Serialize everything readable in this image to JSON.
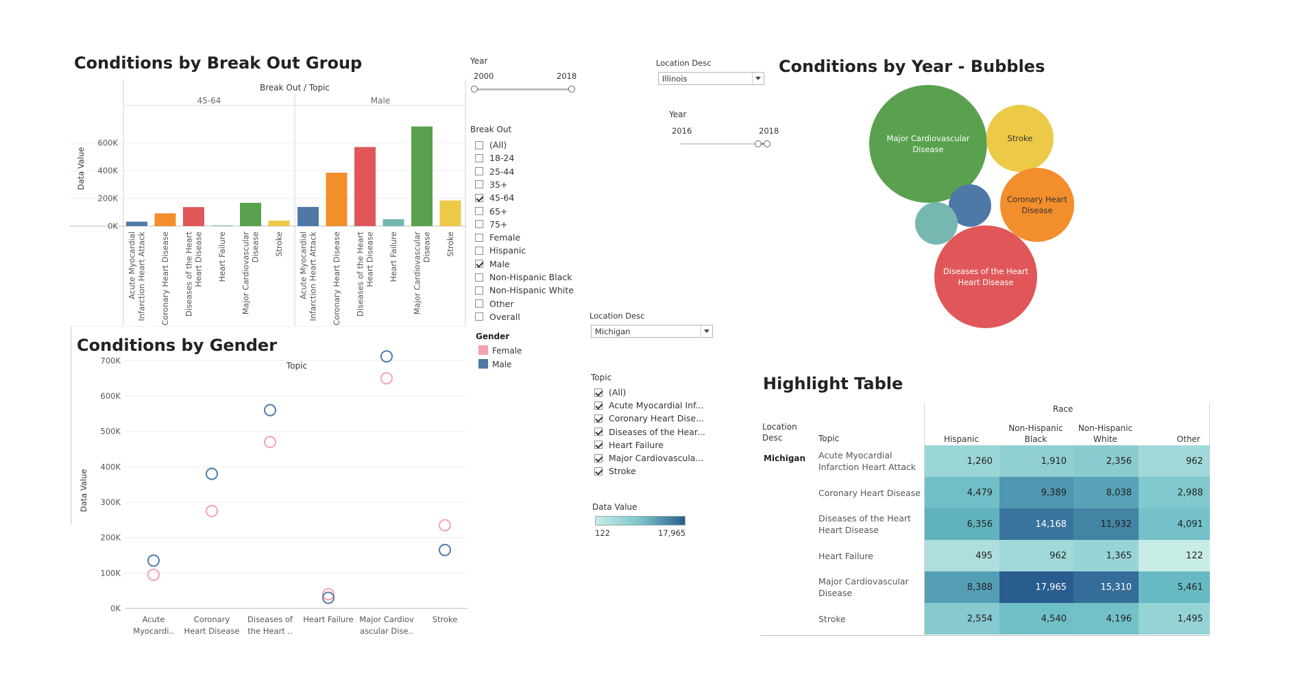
{
  "panels": {
    "breakout_title": "Conditions by Break Out Group",
    "gender_title": "Conditions by Gender",
    "bubbles_title": "Conditions by Year - Bubbles",
    "highlight_title": "Highlight Table"
  },
  "filters": {
    "year1": {
      "label": "Year",
      "min": "2000",
      "max": "2018"
    },
    "breakout": {
      "label": "Break Out",
      "items": [
        {
          "label": "(All)",
          "checked": false
        },
        {
          "label": "18-24",
          "checked": false
        },
        {
          "label": "25-44",
          "checked": false
        },
        {
          "label": "35+",
          "checked": false
        },
        {
          "label": "45-64",
          "checked": true
        },
        {
          "label": "65+",
          "checked": false
        },
        {
          "label": "75+",
          "checked": false
        },
        {
          "label": "Female",
          "checked": false
        },
        {
          "label": "Hispanic",
          "checked": false
        },
        {
          "label": "Male",
          "checked": true
        },
        {
          "label": "Non-Hispanic Black",
          "checked": false
        },
        {
          "label": "Non-Hispanic White",
          "checked": false
        },
        {
          "label": "Other",
          "checked": false
        },
        {
          "label": "Overall",
          "checked": false
        }
      ]
    },
    "gender_legend": {
      "label": "Gender",
      "items": [
        {
          "label": "Female",
          "color": "#f4a3ad"
        },
        {
          "label": "Male",
          "color": "#4e79a7"
        }
      ]
    },
    "location1": {
      "label": "Location Desc",
      "value": "Illinois"
    },
    "year2": {
      "label": "Year",
      "min": "2016",
      "max": "2018"
    },
    "location2": {
      "label": "Location Desc",
      "value": "Michigan"
    },
    "topic": {
      "label": "Topic",
      "items": [
        {
          "label": "(All)",
          "checked": true
        },
        {
          "label": "Acute Myocardial Inf...",
          "checked": true
        },
        {
          "label": "Coronary Heart Dise...",
          "checked": true
        },
        {
          "label": "Diseases of the Hear...",
          "checked": true
        },
        {
          "label": "Heart Failure",
          "checked": true
        },
        {
          "label": "Major Cardiovascula...",
          "checked": true
        },
        {
          "label": "Stroke",
          "checked": true
        }
      ]
    },
    "data_value_legend": {
      "label": "Data Value",
      "min": "122",
      "max": "17,965",
      "color_low": "#c7ece6",
      "color_high": "#2a5d8f"
    }
  },
  "chart_data": [
    {
      "type": "bar",
      "name": "breakout",
      "title": "Conditions by Break Out Group",
      "header": "Break Out / Topic",
      "ylabel": "Data Value",
      "ylim": [
        0,
        800000
      ],
      "yticks": [
        0,
        200000,
        400000,
        600000
      ],
      "ytick_labels": [
        "0K",
        "200K",
        "400K",
        "600K"
      ],
      "groups": [
        "45-64",
        "Male"
      ],
      "categories": [
        "Acute Myocardial Infarction Heart Attack",
        "Coronary Heart Disease",
        "Diseases of the Heart Heart Disease",
        "Heart Failure",
        "Major Cardiovascular Disease",
        "Stroke"
      ],
      "category_lines": [
        [
          "Acute Myocardial",
          "Infarction Heart Attack"
        ],
        [
          "Coronary Heart Disease"
        ],
        [
          "Diseases of the Heart",
          "Heart Disease"
        ],
        [
          "Heart Failure"
        ],
        [
          "Major Cardiovascular",
          "Disease"
        ],
        [
          "Stroke"
        ]
      ],
      "colors": [
        "#4e79a7",
        "#f28e2b",
        "#e15759",
        "#76b7b2",
        "#59a14f",
        "#edc948"
      ],
      "series": [
        {
          "name": "45-64",
          "values": [
            32000,
            92000,
            137000,
            5000,
            168000,
            40000
          ]
        },
        {
          "name": "Male",
          "values": [
            138000,
            385000,
            570000,
            50000,
            718000,
            185000
          ]
        }
      ]
    },
    {
      "type": "scatter",
      "name": "gender",
      "title": "Conditions by Gender",
      "header": "Topic",
      "ylabel": "Data Value",
      "ylim": [
        0,
        740000
      ],
      "yticks": [
        0,
        100000,
        200000,
        300000,
        400000,
        500000,
        600000,
        700000
      ],
      "ytick_labels": [
        "0K",
        "100K",
        "200K",
        "300K",
        "400K",
        "500K",
        "600K",
        "700K"
      ],
      "categories": [
        "Acute Myocardial Infarction Heart Attack",
        "Coronary Heart Disease",
        "Diseases of the Heart Heart Disease",
        "Heart Failure",
        "Major Cardiovascular Disease",
        "Stroke"
      ],
      "category_lines": [
        [
          "Acute",
          "Myocardi.."
        ],
        [
          "Coronary",
          "Heart Disease"
        ],
        [
          "Diseases of",
          "the Heart .."
        ],
        [
          "Heart Failure"
        ],
        [
          "Major Cardiov",
          "ascular Dise.."
        ],
        [
          "Stroke"
        ]
      ],
      "series": [
        {
          "name": "Female",
          "color": "#f4a3ad",
          "values": [
            95000,
            275000,
            470000,
            40000,
            650000,
            235000
          ]
        },
        {
          "name": "Male",
          "color": "#4e79a7",
          "values": [
            135000,
            380000,
            560000,
            30000,
            712000,
            165000
          ]
        }
      ]
    },
    {
      "type": "bubble",
      "name": "bubbles",
      "title": "Conditions by Year - Bubbles",
      "bubbles": [
        {
          "label": [
            "Major Cardiovascular",
            "Disease"
          ],
          "color": "#59a14f",
          "value": 1000
        },
        {
          "label": [
            "Stroke"
          ],
          "color": "#edc948",
          "value": 330
        },
        {
          "label": [
            "Coronary Heart",
            "Disease"
          ],
          "color": "#f28e2b",
          "value": 380
        },
        {
          "label": [
            "Diseases of the Heart",
            "Heart Disease"
          ],
          "color": "#e15759",
          "value": 740
        },
        {
          "label": [],
          "color": "#4e79a7",
          "value": 130
        },
        {
          "label": [],
          "color": "#76b7b2",
          "value": 130
        }
      ]
    },
    {
      "type": "table",
      "name": "highlight",
      "title": "Highlight Table",
      "col_group": "Race",
      "row_headers": [
        "Location Desc",
        "Topic"
      ],
      "location": "Michigan",
      "columns": [
        "Hispanic",
        "Non-Hispanic Black",
        "Non-Hispanic White",
        "Other"
      ],
      "column_lines": [
        [
          "Hispanic"
        ],
        [
          "Non-Hispanic",
          "Black"
        ],
        [
          "Non-Hispanic",
          "White"
        ],
        [
          "Other"
        ]
      ],
      "rows": [
        {
          "topic": [
            "Acute Myocardial",
            "Infarction Heart Attack"
          ],
          "values": [
            "1,260",
            "1,910",
            "2,356",
            "962"
          ],
          "nums": [
            1260,
            1910,
            2356,
            962
          ]
        },
        {
          "topic": [
            "Coronary Heart Disease"
          ],
          "values": [
            "4,479",
            "9,389",
            "8,038",
            "2,988"
          ],
          "nums": [
            4479,
            9389,
            8038,
            2988
          ]
        },
        {
          "topic": [
            "Diseases of the Heart",
            "Heart Disease"
          ],
          "values": [
            "6,356",
            "14,168",
            "11,932",
            "4,091"
          ],
          "nums": [
            6356,
            14168,
            11932,
            4091
          ]
        },
        {
          "topic": [
            "Heart Failure"
          ],
          "values": [
            "495",
            "962",
            "1,365",
            "122"
          ],
          "nums": [
            495,
            962,
            1365,
            122
          ]
        },
        {
          "topic": [
            "Major Cardiovascular",
            "Disease"
          ],
          "values": [
            "8,388",
            "17,965",
            "15,310",
            "5,461"
          ],
          "nums": [
            8388,
            17965,
            15310,
            5461
          ]
        },
        {
          "topic": [
            "Stroke"
          ],
          "values": [
            "2,554",
            "4,540",
            "4,196",
            "1,495"
          ],
          "nums": [
            2554,
            4540,
            4196,
            1495
          ]
        }
      ]
    }
  ]
}
